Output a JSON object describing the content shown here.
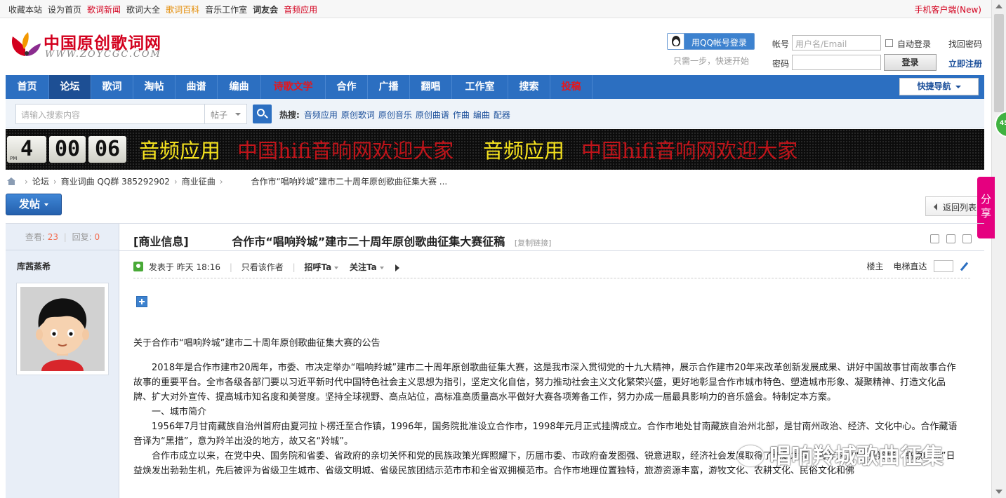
{
  "topbar": {
    "links": [
      {
        "label": "收藏本站",
        "style": ""
      },
      {
        "label": "设为首页",
        "style": ""
      },
      {
        "label": "歌词新闻",
        "style": "red"
      },
      {
        "label": "歌词大全",
        "style": ""
      },
      {
        "label": "歌词百科",
        "style": "orange"
      },
      {
        "label": "音乐工作室",
        "style": ""
      },
      {
        "label": "词友会",
        "style": "bold"
      },
      {
        "label": "音频应用",
        "style": "red"
      }
    ],
    "mobile": "手机客户端(New)"
  },
  "logo": {
    "cn": "中国原创歌词网",
    "en": "WWW.ZOYCGC.COM"
  },
  "qq": {
    "button": "用QQ帐号登录",
    "sub": "只需一步，快速开始"
  },
  "login": {
    "account_label": "帐号",
    "account_placeholder": "用户名/Email",
    "auto_login": "自动登录",
    "find_password": "找回密码",
    "password_label": "密码",
    "login_button": "登录",
    "register": "立即注册"
  },
  "nav": {
    "items": [
      {
        "label": "首页"
      },
      {
        "label": "论坛",
        "active": true
      },
      {
        "label": "歌词"
      },
      {
        "label": "淘帖"
      },
      {
        "label": "曲谱"
      },
      {
        "label": "编曲"
      },
      {
        "label": "诗歌文学",
        "red": true
      },
      {
        "label": "合作"
      },
      {
        "label": "广播"
      },
      {
        "label": "翻唱"
      },
      {
        "label": "工作室"
      },
      {
        "label": "搜索"
      },
      {
        "label": "投稿",
        "red": true
      }
    ],
    "quick_nav": "快捷导航"
  },
  "search": {
    "placeholder": "请输入搜索内容",
    "type": "帖子",
    "hot_label": "热搜:",
    "hot": [
      "音频应用",
      "原创歌词",
      "原创音乐",
      "原创曲谱",
      "作曲",
      "编曲",
      "配器"
    ]
  },
  "banner": {
    "clock": [
      "4",
      "00",
      "06"
    ],
    "pm": "PM",
    "texts": [
      {
        "text": "音频应用",
        "color": "y"
      },
      {
        "text": "中国hifi音响网欢迎大家",
        "color": "r"
      },
      {
        "text": "音频应用",
        "color": "y"
      },
      {
        "text": "中国hifi音响网欢迎大家",
        "color": "r"
      }
    ]
  },
  "breadcrumb": [
    "论坛",
    "商业词曲 QQ群 385292902",
    "商业征曲",
    "合作市“唱响羚城”建市二十周年原创歌曲征集大赛 ..."
  ],
  "post_button": "发帖",
  "back_button": "返回列表",
  "share": "分享",
  "bubble": "45",
  "thread": {
    "views_label": "查看:",
    "views": "23",
    "replies_label": "回复:",
    "replies": "0",
    "author": "库茜蒸希",
    "category": "[商业信息]",
    "title": "合作市“唱响羚城”建市二十周年原创歌曲征集大赛征稿",
    "copy_link": "[复制链接]",
    "posted": "发表于 昨天 18:16",
    "only_author": "只看该作者",
    "greet": "招呼Ta",
    "follow": "关注Ta",
    "floor": "楼主",
    "elevator": "电梯直达"
  },
  "content": {
    "heading": "关于合作市“唱响羚城”建市二十周年原创歌曲征集大赛的公告",
    "p1": "2018年是合作市建市20周年，市委、市决定举办“唱响羚城”建市二十周年原创歌曲征集大赛，这是我市深入贯彻党的十九大精神，展示合作建市20年来改革创新发展成果、讲好中国故事甘南故事合作故事的重要平台。全市各级各部门要以习近平新时代中国特色社会主义思想为指引，坚定文化自信，努力推动社会主义文化繁荣兴盛，更好地彰显合作市城市特色、塑造城市形象、凝聚精神、打造文化品牌、扩大对外宣传、提高城市知名度和美誉度。坚持全球视野、高点站位，高标准高质量高水平做好大赛各项筹备工作，努力办成一届最具影响力的音乐盛会。特制定本方案。",
    "p2": "一、城市简介",
    "p3": "1956年7月甘南藏族自治州首府由夏河拉卜楞迁至合作镇，1996年，国务院批准设立合作市，1998年元月正式挂牌成立。合作市地处甘南藏族自治州北部，是甘南州政治、经济、文化中心。合作藏语音译为“黑措”，意为羚羊出没的地方，故又名“羚城”。",
    "p4": "合作市成立以来，在党中央、国务院和省委、省政府的亲切关怀和党的民族政策光辉照耀下，历届市委、市政府奋发图强、锐意进取，经济社会发展取得了长足发展，合作这座“大美羚城、高原明珠”日益焕发出勃勃生机，先后被评为省级卫生城市、省级文明城、省级民族团结示范市市和全省双拥模范市。合作市地理位置独特，旅游资源丰富，游牧文化、农耕文化、民俗文化和佛"
  },
  "watermark": "唱响羚城歌曲征集"
}
